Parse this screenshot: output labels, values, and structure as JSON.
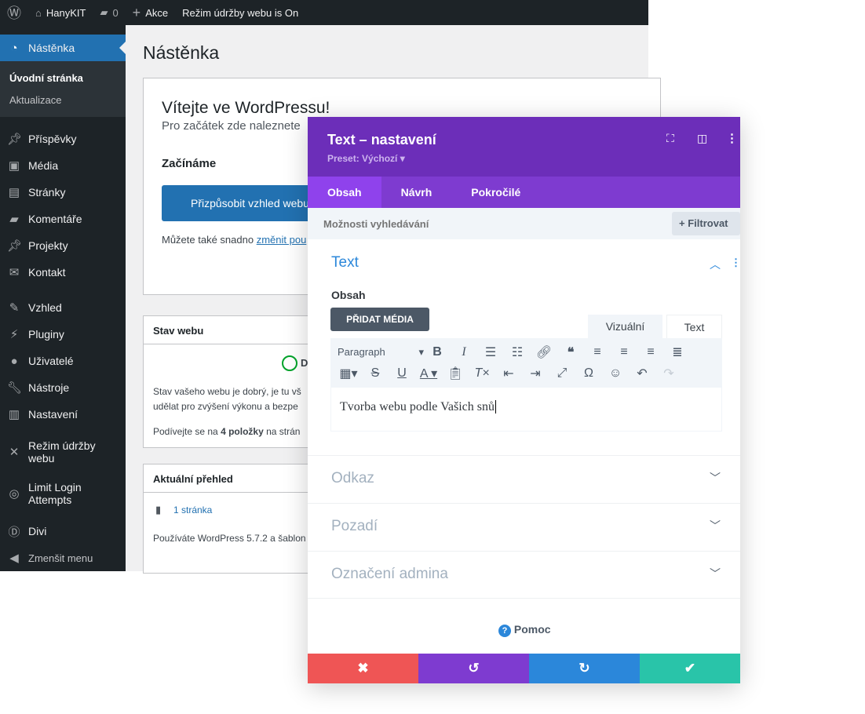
{
  "adminbar": {
    "site": "HanyKIT",
    "comments": "0",
    "new": "Akce",
    "maintenance": "Režim údržby webu is On"
  },
  "sidebar": {
    "active": "Nástěnka",
    "sub": [
      "Úvodní stránka",
      "Aktualizace"
    ],
    "items": [
      {
        "label": "Příspěvky",
        "icon": "pin-icon"
      },
      {
        "label": "Média",
        "icon": "media-icon"
      },
      {
        "label": "Stránky",
        "icon": "pages-icon"
      },
      {
        "label": "Komentáře",
        "icon": "comment-icon"
      },
      {
        "label": "Projekty",
        "icon": "pin-icon"
      },
      {
        "label": "Kontakt",
        "icon": "mail-icon"
      },
      {
        "label": "Vzhled",
        "icon": "brush-icon"
      },
      {
        "label": "Pluginy",
        "icon": "plugin-icon"
      },
      {
        "label": "Uživatelé",
        "icon": "user-icon"
      },
      {
        "label": "Nástroje",
        "icon": "wrench-icon"
      },
      {
        "label": "Nastavení",
        "icon": "settings-icon"
      },
      {
        "label": "Režim údržby webu",
        "icon": "tools-icon"
      },
      {
        "label": "Limit Login Attempts",
        "icon": "fingerprint-icon"
      },
      {
        "label": "Divi",
        "icon": "divi-icon"
      },
      {
        "label": "Zmenšit menu",
        "icon": "collapse-icon"
      }
    ]
  },
  "dashboard": {
    "title": "Nástěnka",
    "welcome": {
      "title": "Vítejte ve WordPressu!",
      "subtitle": "Pro začátek zde naleznete",
      "section": "Začínáme",
      "button": "Přizpůsobit vzhled webu",
      "note_prefix": "Můžete také snadno ",
      "note_link": "změnit pou"
    },
    "health": {
      "title": "Stav webu",
      "status": "D",
      "text1": "Stav vašeho webu je dobrý, je tu vš",
      "text2": "udělat pro zvýšení výkonu a bezpe",
      "text3_prefix": "Podívejte se na ",
      "text3_bold": "4 položky",
      "text3_suffix": " na strán"
    },
    "glance": {
      "title": "Aktuální přehled",
      "pages": "1 stránka",
      "version": "Používáte WordPress 5.7.2 a šablon"
    }
  },
  "modal": {
    "title": "Text – nastavení",
    "preset": "Preset: Výchozí",
    "tabs": [
      "Obsah",
      "Návrh",
      "Pokročilé"
    ],
    "search_placeholder": "Možnosti vyhledávání",
    "filter": "Filtrovat",
    "section": "Text",
    "content_label": "Obsah",
    "add_media": "PŘIDAT MÉDIA",
    "editor_tabs": [
      "Vizuální",
      "Text"
    ],
    "format": "Paragraph",
    "editor_text": "Tvorba webu podle Vašich snů",
    "groups": [
      "Odkaz",
      "Pozadí",
      "Označení admina"
    ],
    "help": "Pomoc",
    "colors": {
      "header": "#6c2eb9",
      "tabs": "#7e3bd0",
      "cancel": "#ef5555",
      "undo": "#7e3bd0",
      "redo": "#2b87da",
      "save": "#29c4a9"
    }
  }
}
